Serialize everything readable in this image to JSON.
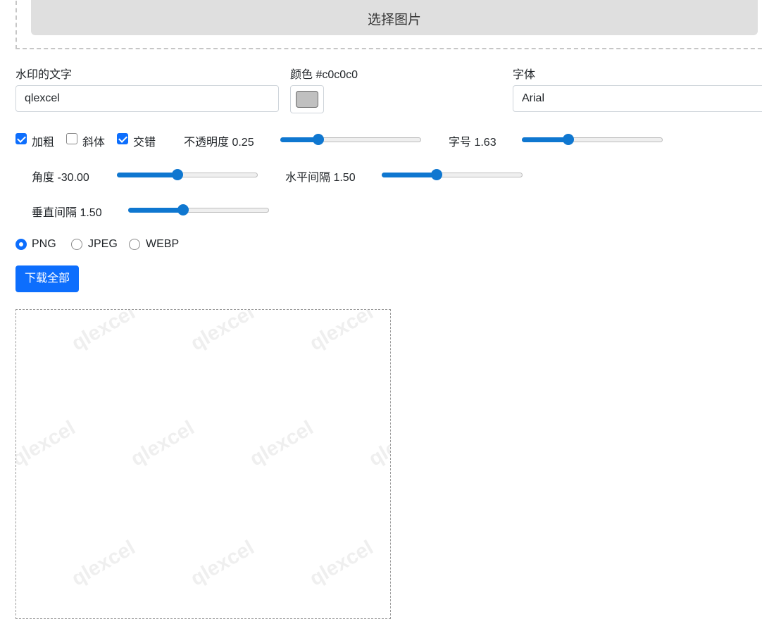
{
  "file_picker": {
    "button_label": "选择图片"
  },
  "watermark_text": {
    "label": "水印的文字",
    "value": "qlexcel"
  },
  "color": {
    "label": "颜色 #c0c0c0",
    "value": "#c0c0c0"
  },
  "font": {
    "label": "字体",
    "value": "Arial"
  },
  "options": {
    "bold": {
      "label": "加粗",
      "checked": true
    },
    "italic": {
      "label": "斜体",
      "checked": false
    },
    "stagger": {
      "label": "交错",
      "checked": true
    }
  },
  "sliders": {
    "opacity": {
      "label": "不透明度 0.25",
      "fraction": 0.27
    },
    "font_size": {
      "label": "字号 1.63",
      "fraction": 0.33
    },
    "angle": {
      "label": "角度 -30.00",
      "fraction": 0.43
    },
    "h_spacing": {
      "label": "水平间隔 1.50",
      "fraction": 0.39
    },
    "v_spacing": {
      "label": "垂直间隔 1.50",
      "fraction": 0.39
    }
  },
  "formats": {
    "png": {
      "label": "PNG",
      "selected": true
    },
    "jpeg": {
      "label": "JPEG",
      "selected": false
    },
    "webp": {
      "label": "WEBP",
      "selected": false
    }
  },
  "download_all": {
    "label": "下载全部"
  },
  "preview": {
    "watermark": "qlexcel"
  },
  "colors": {
    "accent": "#0d6efd",
    "slider": "#0f77d0",
    "watermark": "#c0c0c0"
  }
}
